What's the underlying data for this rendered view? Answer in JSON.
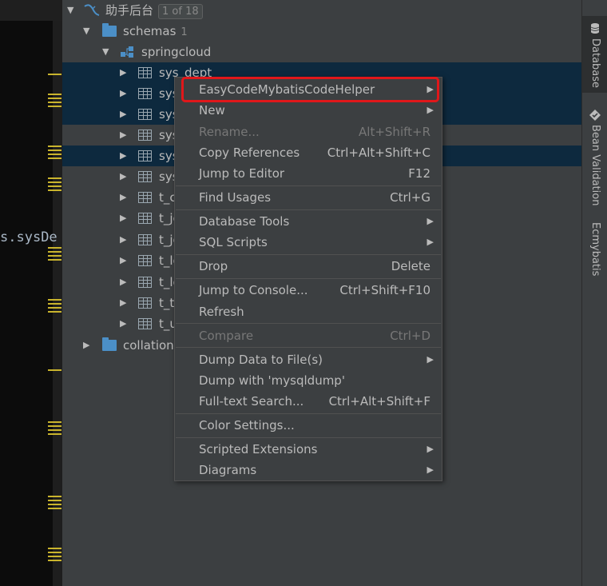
{
  "editor": {
    "code_prefix": "s.",
    "code_ident": "sysDe"
  },
  "tree": {
    "datasource": {
      "label": "助手后台",
      "badge": "1 of 18"
    },
    "schemas": {
      "label": "schemas",
      "count": "1"
    },
    "schema": {
      "label": "springcloud"
    },
    "tables": [
      {
        "label": "sys_dept"
      },
      {
        "label": "sys"
      },
      {
        "label": "sys"
      },
      {
        "label": "sys"
      },
      {
        "label": "sys"
      },
      {
        "label": "sys"
      },
      {
        "label": "t_c"
      },
      {
        "label": "t_jc"
      },
      {
        "label": "t_jc"
      },
      {
        "label": "t_lc"
      },
      {
        "label": "t_lc"
      },
      {
        "label": "t_t"
      },
      {
        "label": "t_u"
      }
    ],
    "collations": {
      "label": "collation"
    }
  },
  "menu": {
    "items": [
      {
        "label": "EasyCodeMybatisCodeHelper",
        "shortcut": "",
        "submenu": true,
        "disabled": false
      },
      {
        "label": "New",
        "shortcut": "",
        "submenu": true,
        "disabled": false
      },
      {
        "label": "Rename...",
        "shortcut": "Alt+Shift+R",
        "submenu": false,
        "disabled": true
      },
      {
        "label": "Copy References",
        "shortcut": "Ctrl+Alt+Shift+C",
        "submenu": false,
        "disabled": false
      },
      {
        "label": "Jump to Editor",
        "shortcut": "F12",
        "submenu": false,
        "disabled": false
      },
      {
        "label": "Find Usages",
        "shortcut": "Ctrl+G",
        "submenu": false,
        "disabled": false
      },
      {
        "label": "Database Tools",
        "shortcut": "",
        "submenu": true,
        "disabled": false
      },
      {
        "label": "SQL Scripts",
        "shortcut": "",
        "submenu": true,
        "disabled": false
      },
      {
        "label": "Drop",
        "shortcut": "Delete",
        "submenu": false,
        "disabled": false
      },
      {
        "label": "Jump to Console...",
        "shortcut": "Ctrl+Shift+F10",
        "submenu": false,
        "disabled": false
      },
      {
        "label": "Refresh",
        "shortcut": "",
        "submenu": false,
        "disabled": false
      },
      {
        "label": "Compare",
        "shortcut": "Ctrl+D",
        "submenu": false,
        "disabled": true
      },
      {
        "label": "Dump Data to File(s)",
        "shortcut": "",
        "submenu": true,
        "disabled": false
      },
      {
        "label": "Dump with 'mysqldump'",
        "shortcut": "",
        "submenu": false,
        "disabled": false
      },
      {
        "label": "Full-text Search...",
        "shortcut": "Ctrl+Alt+Shift+F",
        "submenu": false,
        "disabled": false
      },
      {
        "label": "Color Settings...",
        "shortcut": "",
        "submenu": false,
        "disabled": false
      },
      {
        "label": "Scripted Extensions",
        "shortcut": "",
        "submenu": true,
        "disabled": false
      },
      {
        "label": "Diagrams",
        "shortcut": "",
        "submenu": true,
        "disabled": false
      }
    ]
  },
  "right_strip": {
    "tabs": [
      {
        "label": "Database"
      },
      {
        "label": "Bean Validation"
      },
      {
        "label": "Ecmybatis"
      }
    ]
  },
  "icons": {
    "arrow_right": "▶",
    "arrow_down": "▼",
    "submenu_arrow": "▶"
  },
  "colors": {
    "highlight_border": "#e0171a",
    "selection": "#0d293e",
    "folder": "#4b8fc7"
  }
}
